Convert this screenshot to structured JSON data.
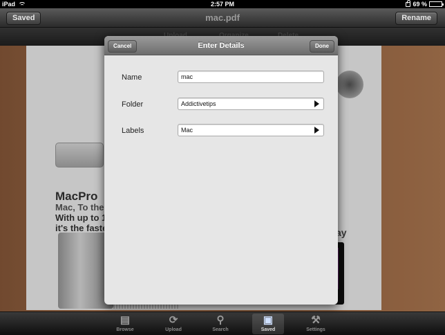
{
  "status_bar": {
    "carrier": "iPad",
    "time": "2:57 PM",
    "battery_percent": "69 %",
    "battery_level": 0.69
  },
  "nav": {
    "back_label": "Saved",
    "title": "mac.pdf",
    "rename_label": "Rename"
  },
  "document": {
    "toolbar_faint": [
      "Upload",
      "Organize",
      "Delete"
    ],
    "headline": "MacPro",
    "line1": "Mac, To the",
    "line2": "With up to 1",
    "line3": "it's the faste",
    "side_text": "ay"
  },
  "modal": {
    "title": "Enter Details",
    "cancel_label": "Cancel",
    "done_label": "Done",
    "fields": [
      {
        "label": "Name",
        "value": "mac"
      },
      {
        "label": "Folder",
        "value": "Addictivetips"
      },
      {
        "label": "Labels",
        "value": "Mac"
      }
    ]
  },
  "tabs": [
    {
      "label": "Browse",
      "icon": "browse-icon",
      "selected": false
    },
    {
      "label": "Upload",
      "icon": "sync-icon",
      "selected": false
    },
    {
      "label": "Search",
      "icon": "search-icon",
      "selected": false
    },
    {
      "label": "Saved",
      "icon": "floppy-icon",
      "selected": true
    },
    {
      "label": "Settings",
      "icon": "tools-icon",
      "selected": false
    }
  ],
  "colors": {
    "modal_bg": "#e6e6e6",
    "bar": "#2b2b2b",
    "selected_tab": "#cfe0ff"
  }
}
